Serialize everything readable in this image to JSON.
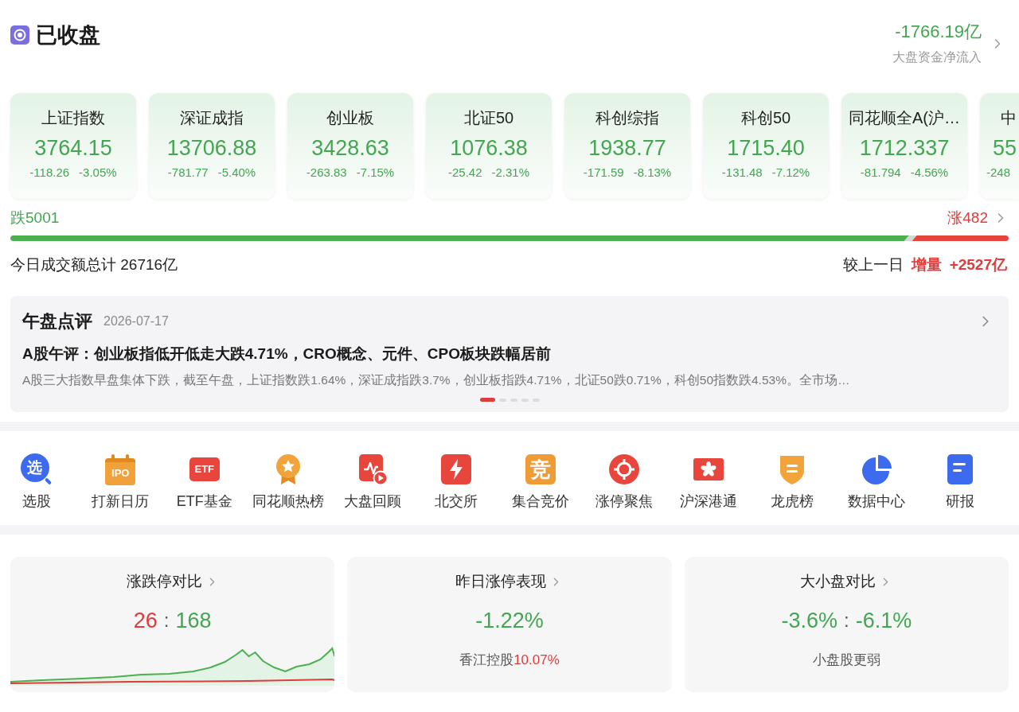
{
  "header": {
    "title": "已收盘",
    "net_inflow": "-1766.19亿",
    "net_inflow_rising": false,
    "net_inflow_label": "大盘资金净流入"
  },
  "indices": [
    {
      "name": "上证指数",
      "value": "3764.15",
      "change": "-118.26",
      "percent": "-3.05%",
      "rising": false,
      "clipped": false
    },
    {
      "name": "深证成指",
      "value": "13706.88",
      "change": "-781.77",
      "percent": "-5.40%",
      "rising": false,
      "clipped": false
    },
    {
      "name": "创业板",
      "value": "3428.63",
      "change": "-263.83",
      "percent": "-7.15%",
      "rising": false,
      "clipped": false
    },
    {
      "name": "北证50",
      "value": "1076.38",
      "change": "-25.42",
      "percent": "-2.31%",
      "rising": false,
      "clipped": false
    },
    {
      "name": "科创综指",
      "value": "1938.77",
      "change": "-171.59",
      "percent": "-8.13%",
      "rising": false,
      "clipped": false
    },
    {
      "name": "科创50",
      "value": "1715.40",
      "change": "-131.48",
      "percent": "-7.12%",
      "rising": false,
      "clipped": false
    },
    {
      "name": "同花顺全A(沪…",
      "value": "1712.337",
      "change": "-81.794",
      "percent": "-4.56%",
      "rising": false,
      "clipped": false
    },
    {
      "name": "中",
      "value": "55",
      "change": "-248",
      "rising": false,
      "clipped": true
    }
  ],
  "breadth": {
    "fall": "跌5001",
    "rise": "涨482",
    "level": 0.9
  },
  "turnover": {
    "total": "今日成交额总计 26716亿",
    "compare_label": "较上一日",
    "change_label": "增量",
    "change": "+2527亿"
  },
  "review": {
    "title": "午盘点评",
    "date": "2026-07-17",
    "headline": "A股午评：创业板指低开低走大跌4.71%，CRO概念、元件、CPO板块跌幅居前",
    "summary": "A股三大指数早盘集体下跌，截至午盘，上证指数跌1.64%，深证成指跌3.7%，创业板指跌4.71%，北证50跌0.71%，科创50指数跌4.53%。全市场…",
    "pages": [
      {
        "selected": true
      },
      {
        "selected": false
      },
      {
        "selected": false
      },
      {
        "selected": false
      },
      {
        "selected": false
      }
    ]
  },
  "shortcuts": [
    {
      "label": "选股",
      "kind": "glyph-search",
      "glyph": "选"
    },
    {
      "label": "打新日历",
      "kind": "calendar",
      "glyph": "IPO"
    },
    {
      "label": "ETF基金",
      "kind": "tag",
      "glyph": "ETF"
    },
    {
      "label": "同花顺热榜",
      "kind": "medal"
    },
    {
      "label": "大盘回顾",
      "kind": "chart-play"
    },
    {
      "label": "北交所",
      "kind": "bolt"
    },
    {
      "label": "集合竞价",
      "kind": "glyph-square",
      "glyph": "竞"
    },
    {
      "label": "涨停聚焦",
      "kind": "target"
    },
    {
      "label": "沪深港通",
      "kind": "flower"
    },
    {
      "label": "龙虎榜",
      "kind": "shield"
    },
    {
      "label": "数据中心",
      "kind": "pie"
    },
    {
      "label": "研报",
      "kind": "doc"
    }
  ],
  "panels": [
    {
      "title": "涨跌停对比",
      "values": [
        {
          "text": "26",
          "rising": true
        },
        {
          "text": "168",
          "rising": false
        }
      ],
      "separator": ":",
      "sparkline": true
    },
    {
      "title": "昨日涨停表现",
      "values": [
        {
          "text": "-1.22%",
          "rising": false
        }
      ],
      "note": "香江控股",
      "note_value": "10.07%",
      "note_rising": true
    },
    {
      "title": "大小盘对比",
      "values": [
        {
          "text": "-3.6%",
          "rising": false
        },
        {
          "text": "-6.1%",
          "rising": false
        }
      ],
      "separator": ":",
      "note": "小盘股更弱"
    }
  ]
}
